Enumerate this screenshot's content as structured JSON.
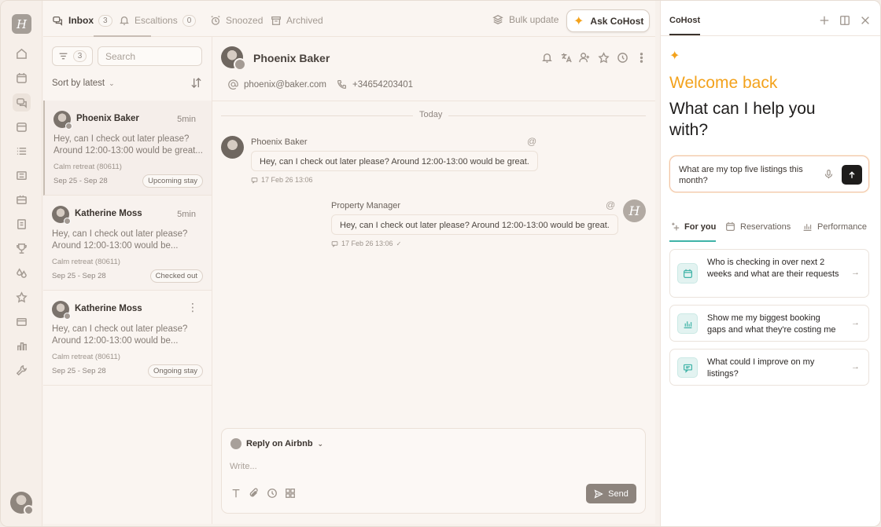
{
  "brand": {
    "logo_letter": "H",
    "accent": "#f3a21c",
    "teal": "#3fb3a7"
  },
  "rail": {
    "items": [
      "home-icon",
      "calendar-icon",
      "inbox-icon",
      "calendar-alt-icon",
      "list-icon",
      "grid-icon",
      "ticket-icon",
      "document-icon",
      "trophy-icon",
      "drops-icon",
      "star-icon",
      "card-icon",
      "chart-icon",
      "wrench-icon"
    ]
  },
  "tabs": {
    "inbox": {
      "label": "Inbox",
      "count": "3"
    },
    "escalations": {
      "label": "Escaltions",
      "count": "0"
    },
    "snoozed": {
      "label": "Snoozed"
    },
    "archived": {
      "label": "Archived"
    },
    "bulk_update": "Bulk update",
    "ask_cohost": "Ask CoHost"
  },
  "list": {
    "filter_count": "3",
    "search_placeholder": "Search",
    "sort_label": "Sort by latest",
    "conversations": [
      {
        "name": "Phoenix Baker",
        "time": "5min",
        "message": "Hey, can I check out later please? Around 12:00-13:00 would be great...",
        "listing": "Calm retreat (80611)",
        "dates": "Sep 25 - Sep 28",
        "badge": "Upcoming stay"
      },
      {
        "name": "Katherine Moss",
        "time": "5min",
        "message": "Hey, can I check out later please? Around 12:00-13:00 would be...",
        "listing": "Calm retreat (80611)",
        "dates": "Sep 25 - Sep 28",
        "badge": "Checked out"
      },
      {
        "name": "Katherine Moss",
        "time": "",
        "message": "Hey, can I check out later please? Around 12:00-13:00 would be...",
        "listing": "Calm retreat (80611)",
        "dates": "Sep 25 - Sep 28",
        "badge": "Ongoing stay"
      }
    ]
  },
  "chat": {
    "guest_name": "Phoenix Baker",
    "email": "phoenix@baker.com",
    "phone": "+34654203401",
    "day_label": "Today",
    "messages": [
      {
        "sender": "Phoenix Baker",
        "text": "Hey, can I check out later please? Around 12:00-13:00 would be great.",
        "time": "17 Feb 26 13:06"
      },
      {
        "sender": "Property Manager",
        "avatar_letter": "H",
        "text": "Hey, can I check out later please? Around 12:00-13:00 would be great.",
        "time": "17 Feb 26 13:06"
      }
    ],
    "composer": {
      "reply_on": "Reply on Airbnb",
      "placeholder": "Write...",
      "send_label": "Send"
    }
  },
  "cohost": {
    "title": "CoHost",
    "welcome": "Welcome back",
    "question": "What can I help you with?",
    "input_value": "What are my top five listings this month?",
    "tabs": {
      "for_you": "For you",
      "reservations": "Reservations",
      "performance": "Performance"
    },
    "suggestions": [
      {
        "icon": "calendar-icon",
        "text": "Who is checking in over next 2 weeks and what are their requests"
      },
      {
        "icon": "bar-chart-icon",
        "text": "Show me my biggest booking gaps and what they're costing me"
      },
      {
        "icon": "message-icon",
        "text": "What could I improve on my listings?"
      }
    ]
  }
}
